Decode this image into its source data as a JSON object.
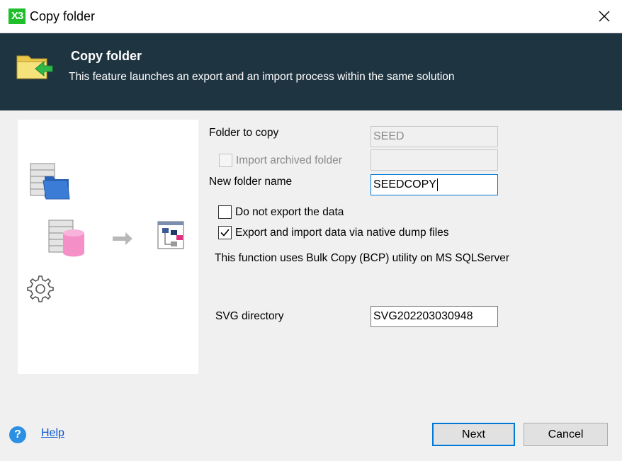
{
  "window": {
    "title": "Copy folder",
    "app_icon_text": "X3"
  },
  "banner": {
    "title": "Copy folder",
    "subtitle": "This feature launches an export and an import process within the same solution"
  },
  "form": {
    "folder_to_copy_label": "Folder to copy",
    "folder_to_copy_value": "SEED",
    "import_archived_label": "Import archived folder",
    "import_archived_checked": false,
    "import_archived_value": "",
    "new_folder_label": "New folder name",
    "new_folder_value": "SEEDCOPY",
    "do_not_export_label": "Do not export the data",
    "do_not_export_checked": false,
    "native_dump_label": "Export and import data via native dump files",
    "native_dump_checked": true,
    "bcp_info": "This function uses Bulk Copy (BCP) utility on MS SQLServer",
    "svg_dir_label": "SVG directory",
    "svg_dir_value": "SVG202203030948"
  },
  "footer": {
    "help_label": "Help",
    "next_label": "Next",
    "cancel_label": "Cancel"
  },
  "colors": {
    "banner_bg": "#1f3441",
    "accent": "#0078d7",
    "folder_yellow": "#f3dc5a",
    "arrow_green": "#2fb84a",
    "db_pink": "#f48fc8",
    "folder_blue": "#3b7dd6"
  }
}
